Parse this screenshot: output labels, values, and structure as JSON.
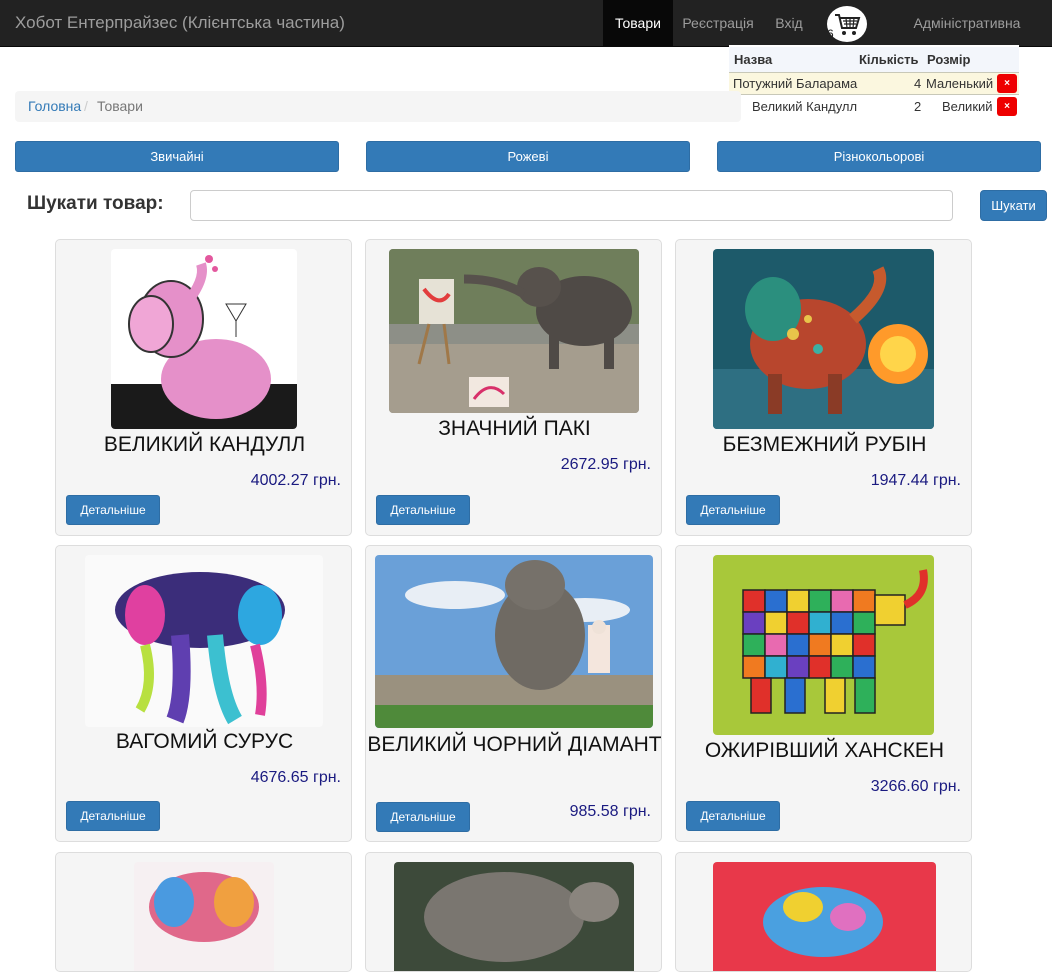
{
  "navbar": {
    "brand": "Хобот Ентерпрайзес (Клієнтська частина)",
    "items": [
      {
        "label": "Товари"
      },
      {
        "label": "Реєстрація"
      },
      {
        "label": "Вхід"
      },
      {
        "label": "Адміністративна частина"
      }
    ],
    "cart_count": "6",
    "cart_icon": "shopping-cart-icon"
  },
  "cart": {
    "headers": {
      "name": "Назва",
      "qty": "Кількість",
      "size": "Розмір"
    },
    "rows": [
      {
        "name": "Потужний Баларама",
        "qty": "4",
        "size": "Маленький",
        "remove": "×"
      },
      {
        "name": "Великий Кандулл",
        "qty": "2",
        "size": "Великий",
        "remove": "×"
      }
    ]
  },
  "breadcrumb": {
    "home": "Головна",
    "separator": "/",
    "current": "Товари"
  },
  "categories": [
    "Звичайні",
    "Рожеві",
    "Різнокольорові"
  ],
  "search": {
    "label": "Шукати товар:",
    "value": "",
    "button": "Шукати"
  },
  "products": [
    {
      "name": "ВЕЛИКИЙ КАНДУЛЛ",
      "price": "4002.27 грн.",
      "button": "Детальніше"
    },
    {
      "name": "ЗНАЧНИЙ ПАКІ",
      "price": "2672.95 грн.",
      "button": "Детальніше"
    },
    {
      "name": "БЕЗМЕЖНИЙ РУБІН",
      "price": "1947.44 грн.",
      "button": "Детальніше"
    },
    {
      "name": "ВАГОМИЙ СУРУС",
      "price": "4676.65 грн.",
      "button": "Детальніше"
    },
    {
      "name": "ВЕЛИКИЙ ЧОРНИЙ ДІАМАНТ",
      "price": "985.58 грн.",
      "button": "Детальніше"
    },
    {
      "name": "ОЖИРІВШИЙ ХАНСКЕН",
      "price": "3266.60 грн.",
      "button": "Детальніше"
    }
  ]
}
